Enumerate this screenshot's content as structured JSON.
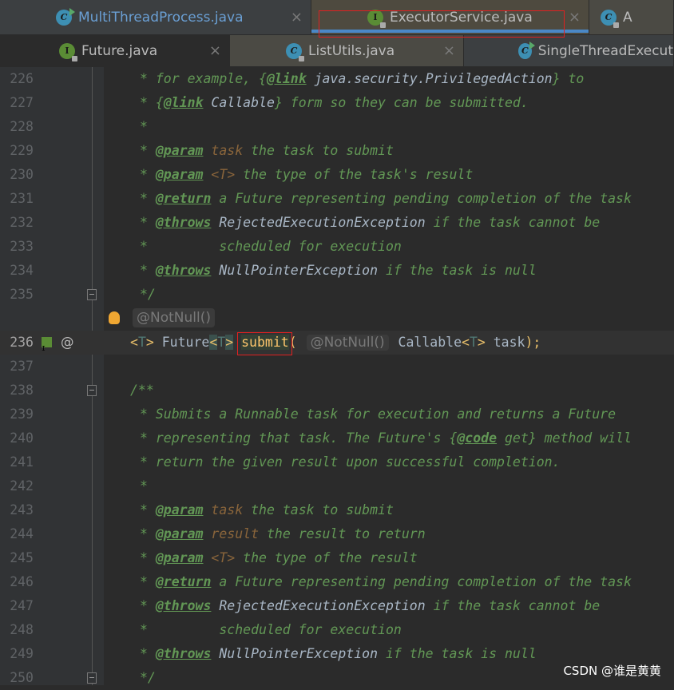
{
  "tabs_row1": [
    {
      "label": "MultiThreadProcess.java",
      "icon": "class-run-icon",
      "kind": "c",
      "run": true
    },
    {
      "label": "ExecutorService.java",
      "icon": "interface-icon",
      "kind": "i",
      "lock": true,
      "active": true
    },
    {
      "label": "A",
      "icon": "class-icon",
      "kind": "c",
      "lock": true
    }
  ],
  "tabs_row2": [
    {
      "label": "Future.java",
      "icon": "interface-icon",
      "kind": "i",
      "lock": true
    },
    {
      "label": "ListUtils.java",
      "icon": "class-icon",
      "kind": "c",
      "lock": true
    },
    {
      "label": "SingleThreadExecut",
      "icon": "class-run-icon",
      "kind": "c",
      "run": true
    }
  ],
  "close_glyph": "×",
  "hint_above": "@NotNull()",
  "lines": [
    {
      "n": "226",
      "seg": [
        [
          "c",
          "* for example, {"
        ],
        [
          "tag",
          "@link"
        ],
        [
          "ref",
          " java.security.PrivilegedAction"
        ],
        [
          "c",
          "} to"
        ]
      ],
      "indent": 1
    },
    {
      "n": "227",
      "seg": [
        [
          "c",
          "* {"
        ],
        [
          "tag",
          "@link"
        ],
        [
          "ref",
          " Callable"
        ],
        [
          "c",
          "} form so they can be submitted."
        ]
      ],
      "indent": 1
    },
    {
      "n": "228",
      "seg": [
        [
          "c",
          "*"
        ]
      ],
      "indent": 1
    },
    {
      "n": "229",
      "seg": [
        [
          "c",
          "* "
        ],
        [
          "tag",
          "@param"
        ],
        [
          "pn",
          " task"
        ],
        [
          "c",
          " the task to submit"
        ]
      ],
      "indent": 1
    },
    {
      "n": "230",
      "seg": [
        [
          "c",
          "* "
        ],
        [
          "tag",
          "@param"
        ],
        [
          "pn",
          " <T>"
        ],
        [
          "c",
          " the type of the task's result"
        ]
      ],
      "indent": 1
    },
    {
      "n": "231",
      "seg": [
        [
          "c",
          "* "
        ],
        [
          "tag",
          "@return"
        ],
        [
          "c",
          " a Future representing pending completion of the task"
        ]
      ],
      "indent": 1
    },
    {
      "n": "232",
      "seg": [
        [
          "c",
          "* "
        ],
        [
          "tag",
          "@throws"
        ],
        [
          "ref",
          " RejectedExecutionException"
        ],
        [
          "c",
          " if the task cannot be"
        ]
      ],
      "indent": 1
    },
    {
      "n": "233",
      "seg": [
        [
          "c",
          "*         scheduled for execution"
        ]
      ],
      "indent": 1
    },
    {
      "n": "234",
      "seg": [
        [
          "c",
          "* "
        ],
        [
          "tag",
          "@throws"
        ],
        [
          "ref",
          " NullPointerException"
        ],
        [
          "c",
          " if the task is null"
        ]
      ],
      "indent": 1
    },
    {
      "n": "235",
      "seg": [
        [
          "c",
          "*/"
        ]
      ],
      "indent": 1,
      "fold": true
    },
    {
      "n": "236",
      "cur": true,
      "seg": [
        [
          "br",
          "<"
        ],
        [
          "tp",
          "T"
        ],
        [
          "br",
          ">"
        ],
        [
          "plain",
          " Future"
        ],
        [
          "brh",
          "<"
        ],
        [
          "tp",
          "T"
        ],
        [
          "brh",
          ">"
        ],
        [
          "plain",
          " "
        ],
        [
          "fn",
          "submit"
        ],
        [
          "br",
          "("
        ],
        [
          "plain",
          " "
        ],
        [
          "hint",
          "@NotNull()"
        ],
        [
          "plain",
          " Callable"
        ],
        [
          "br",
          "<"
        ],
        [
          "tp",
          "T"
        ],
        [
          "br",
          ">"
        ],
        [
          "plain",
          " task"
        ],
        [
          "br",
          ")"
        ],
        [
          "br",
          ";"
        ]
      ]
    },
    {
      "n": "237",
      "seg": []
    },
    {
      "n": "238",
      "seg": [
        [
          "c",
          "/**"
        ]
      ],
      "fold": true
    },
    {
      "n": "239",
      "seg": [
        [
          "c",
          "* Submits a Runnable task for execution and returns a Future"
        ]
      ],
      "indent": 1
    },
    {
      "n": "240",
      "seg": [
        [
          "c",
          "* representing that task. The Future's {"
        ],
        [
          "tag",
          "@code"
        ],
        [
          "c",
          " get} method will"
        ]
      ],
      "indent": 1
    },
    {
      "n": "241",
      "seg": [
        [
          "c",
          "* return the given result upon successful completion."
        ]
      ],
      "indent": 1
    },
    {
      "n": "242",
      "seg": [
        [
          "c",
          "*"
        ]
      ],
      "indent": 1
    },
    {
      "n": "243",
      "seg": [
        [
          "c",
          "* "
        ],
        [
          "tag",
          "@param"
        ],
        [
          "pn",
          " task"
        ],
        [
          "c",
          " the task to submit"
        ]
      ],
      "indent": 1
    },
    {
      "n": "244",
      "seg": [
        [
          "c",
          "* "
        ],
        [
          "tag",
          "@param"
        ],
        [
          "pn",
          " result"
        ],
        [
          "c",
          " the result to return"
        ]
      ],
      "indent": 1
    },
    {
      "n": "245",
      "seg": [
        [
          "c",
          "* "
        ],
        [
          "tag",
          "@param"
        ],
        [
          "pn",
          " <T>"
        ],
        [
          "c",
          " the type of the result"
        ]
      ],
      "indent": 1
    },
    {
      "n": "246",
      "seg": [
        [
          "c",
          "* "
        ],
        [
          "tag",
          "@return"
        ],
        [
          "c",
          " a Future representing pending completion of the task"
        ]
      ],
      "indent": 1
    },
    {
      "n": "247",
      "seg": [
        [
          "c",
          "* "
        ],
        [
          "tag",
          "@throws"
        ],
        [
          "ref",
          " RejectedExecutionException"
        ],
        [
          "c",
          " if the task cannot be"
        ]
      ],
      "indent": 1
    },
    {
      "n": "248",
      "seg": [
        [
          "c",
          "*         scheduled for execution"
        ]
      ],
      "indent": 1
    },
    {
      "n": "249",
      "seg": [
        [
          "c",
          "* "
        ],
        [
          "tag",
          "@throws"
        ],
        [
          "ref",
          " NullPointerException"
        ],
        [
          "c",
          " if the task is null"
        ]
      ],
      "indent": 1
    },
    {
      "n": "250",
      "seg": [
        [
          "c",
          "*/"
        ]
      ],
      "indent": 1,
      "fold": true
    }
  ],
  "gutter_236_at": "@",
  "watermark": "CSDN @谁是黄黄"
}
